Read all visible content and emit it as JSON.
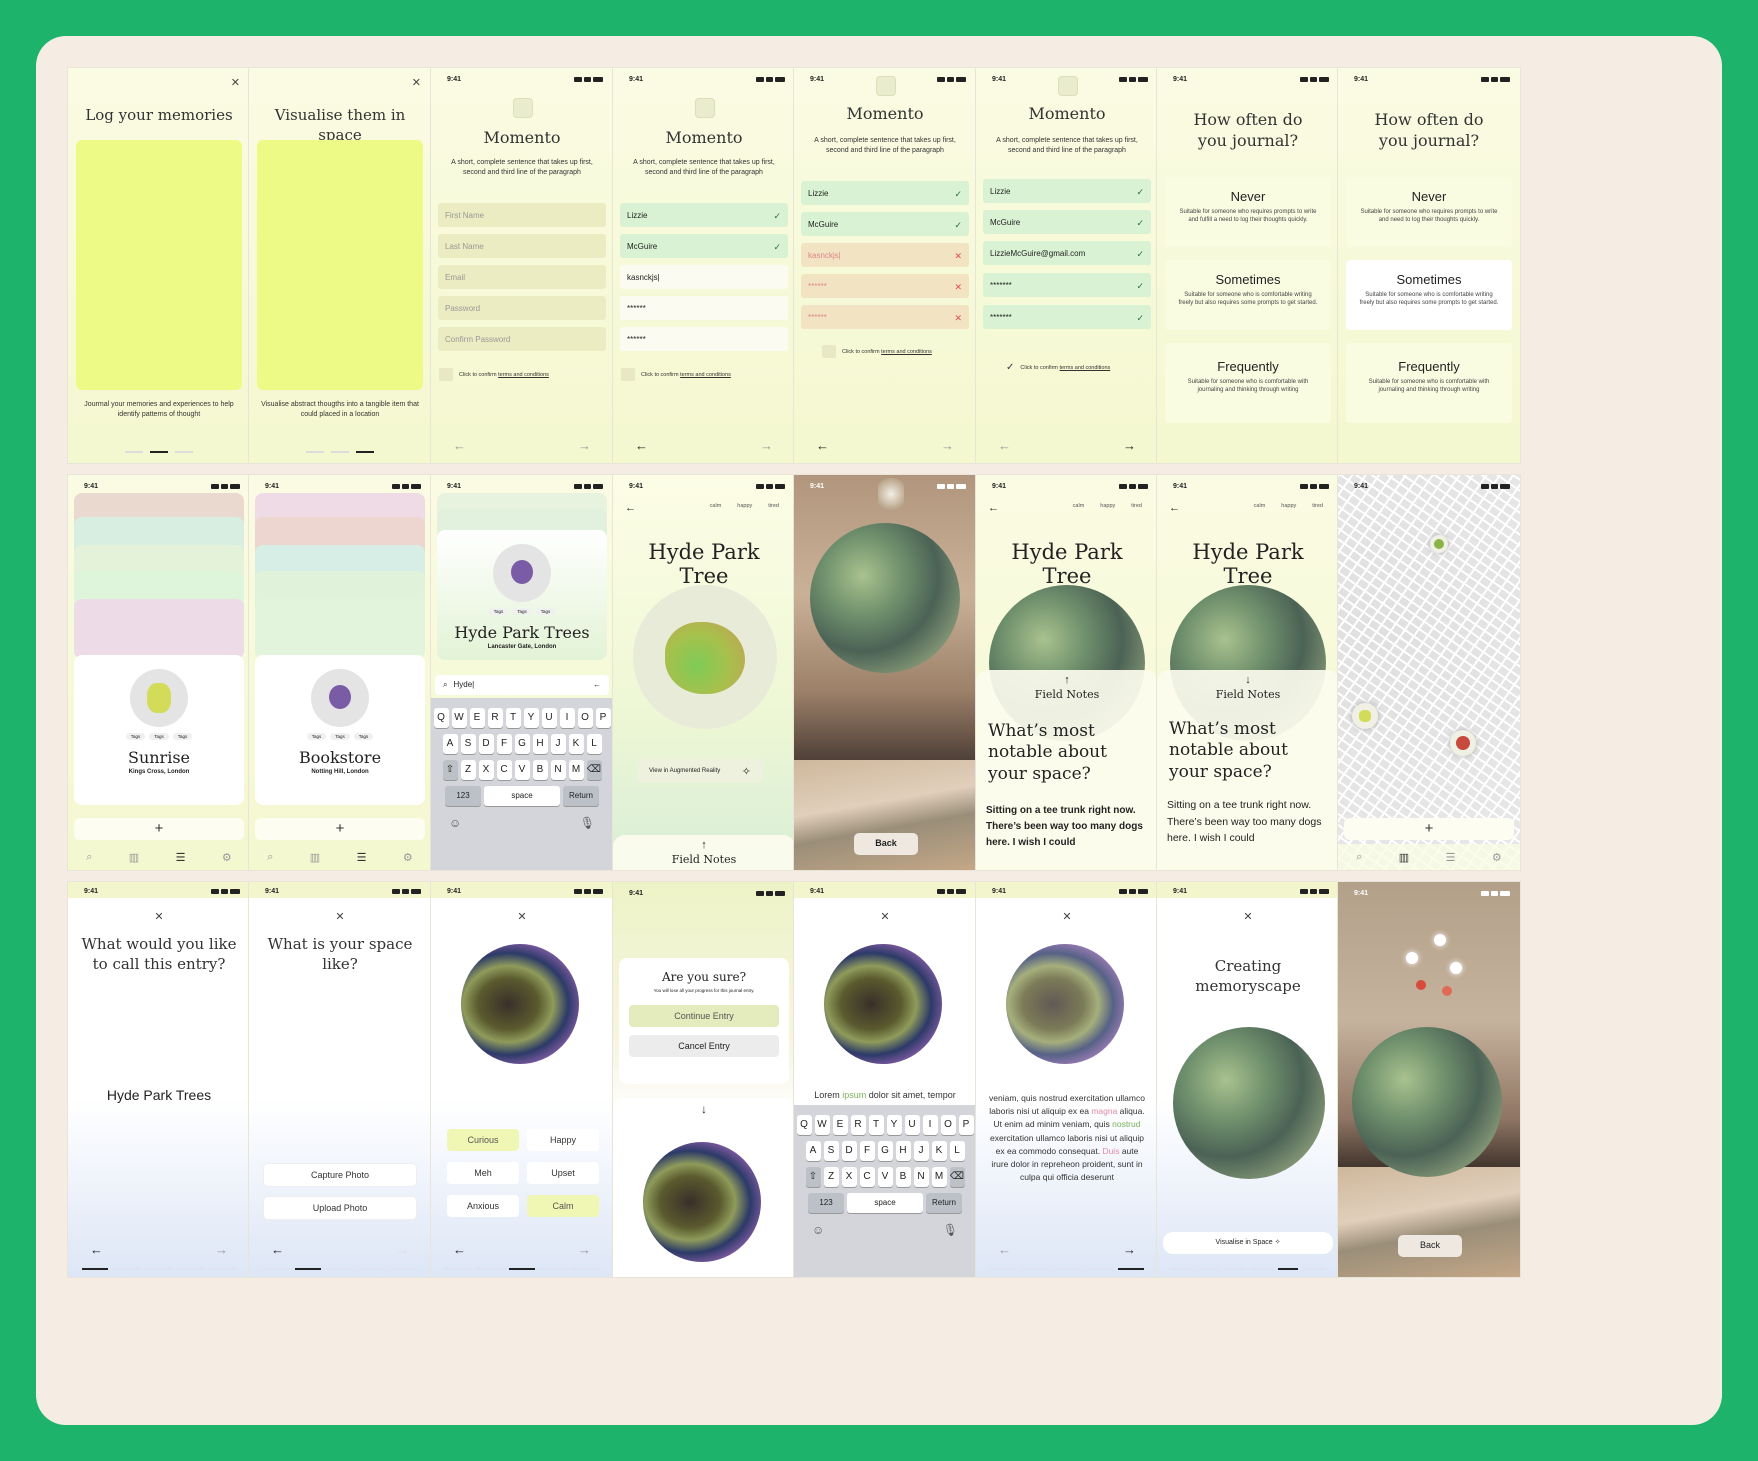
{
  "status": {
    "time": "9:41"
  },
  "row1": {
    "s1": {
      "title": "Log your memories",
      "caption": "Jourmal your memories and experiences to help identify patterns of thought"
    },
    "s2": {
      "title": "Visualise them in space",
      "caption": "Visualise abstract thougths into a tangible item that could placed in a location"
    },
    "app_name": "Momento",
    "intro": "A short, complete sentence that takes up first, second and third line of the paragraph",
    "placeholders": {
      "first": "First Name",
      "last": "Last Name",
      "email": "Email",
      "password": "Password",
      "confirm": "Confirm Password"
    },
    "values": {
      "first": "Lizzie",
      "last": "McGuire",
      "email_typing": "kasnckjs|",
      "email_err": "kasnckjs|",
      "email_ok": "LizzieMcGuire@gmail.com",
      "pw_mask": "******",
      "pw_mask2": "*******"
    },
    "terms_prefix": "Click to confirm ",
    "terms_link": "terms and conditions",
    "journal_q": "How often do you journal?",
    "options": [
      {
        "t": "Never",
        "d": "Suitable for someone who requires prompts to write and need to log their thoughts quickly."
      },
      {
        "t": "Sometimes",
        "d": "Suitable for someone who is comfortable writing freely but also requires some prompts to get started."
      },
      {
        "t": "Frequently",
        "d": "Suitable for someone who is comfortable with journaling and thinking through writing"
      }
    ],
    "option1_alt": "Suitable for someone who requires prompts to write and fulfill a need to log their thoughts quickly."
  },
  "row2": {
    "tag": "Tags",
    "sunrise": {
      "name": "Sunrise",
      "loc": "Kings Cross, London"
    },
    "bookstore": {
      "name": "Bookstore",
      "loc": "Notting Hill, London"
    },
    "search_card": {
      "name": "Hyde Park Trees",
      "loc": "Lancaster Gate, London"
    },
    "search_value": "Hyde|",
    "keys": {
      "r1": [
        "Q",
        "W",
        "E",
        "R",
        "T",
        "Y",
        "U",
        "I",
        "O",
        "P"
      ],
      "r2": [
        "A",
        "S",
        "D",
        "F",
        "G",
        "H",
        "J",
        "K",
        "L"
      ],
      "r3": [
        "Z",
        "X",
        "C",
        "V",
        "B",
        "N",
        "M"
      ],
      "num": "123",
      "space": "space",
      "ret": "Return"
    },
    "moods": [
      "calm",
      "happy",
      "tired"
    ],
    "entry_title": "Hyde Park Tree",
    "ar_button": "View in Augmented Reality",
    "field_notes": "Field Notes",
    "back": "Back",
    "question": "What’s most notable about your space?",
    "answer": "Sitting on a tee trunk right now. There’s been way too many dogs here. I wish I could"
  },
  "row3": {
    "q_name": "What would you like to call this entry?",
    "entry_name": "Hyde Park Trees",
    "q_space": "What is your space like?",
    "capture": "Capture Photo",
    "upload": "Upload Photo",
    "mood_opts": [
      "Curious",
      "Happy",
      "Meh",
      "Upset",
      "Anxious",
      "Calm"
    ],
    "sure": "Are you sure?",
    "sure_sub": "You will lose all your progress for this journal entry.",
    "continue": "Continue Entry",
    "cancel": "Cancel Entry",
    "lorem_a": "Lorem ",
    "lorem_b": "ipsum",
    "lorem_c": " dolor sit amet, tempor incididunt labore dolore|",
    "long_text": {
      "p1": "veniam, quis nostrud exercitation ullamco laboris nisi ut aliquip ex ea ",
      "m": "magna",
      "p2": " aliqua. Ut enim ad minim veniam, quis ",
      "n": "nostrud",
      "p3": " exercitation ullamco laboris nisi ut aliquip ex ea commodo consequat. ",
      "d": "Duis",
      "p4": " aute irure dolor in repreheon proident, sunt in culpa qui officia deserunt"
    },
    "creating": "Creating memoryscape",
    "visualise": "Visualise in Space"
  }
}
